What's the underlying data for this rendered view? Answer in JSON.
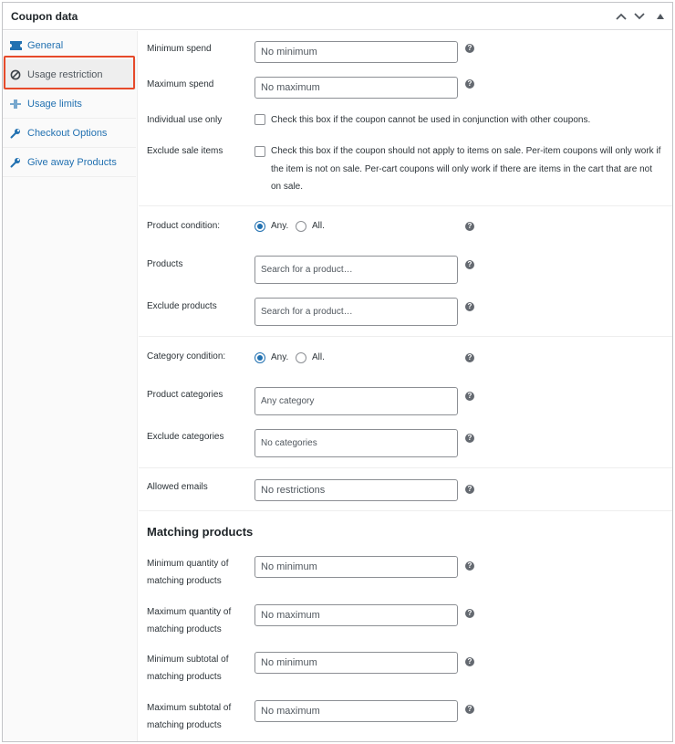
{
  "panel": {
    "title": "Coupon data"
  },
  "tabs": [
    {
      "label": "General",
      "icon": "ticket-icon"
    },
    {
      "label": "Usage restriction",
      "icon": "block-icon",
      "active": true
    },
    {
      "label": "Usage limits",
      "icon": "limits-icon"
    },
    {
      "label": "Checkout Options",
      "icon": "wrench-icon"
    },
    {
      "label": "Give away Products",
      "icon": "wrench-icon"
    }
  ],
  "fields": {
    "minimum_spend": {
      "label": "Minimum spend",
      "placeholder": "No minimum"
    },
    "maximum_spend": {
      "label": "Maximum spend",
      "placeholder": "No maximum"
    },
    "individual_use": {
      "label": "Individual use only",
      "text": "Check this box if the coupon cannot be used in conjunction with other coupons."
    },
    "exclude_sale": {
      "label": "Exclude sale items",
      "text": "Check this box if the coupon should not apply to items on sale. Per-item coupons will only work if the item is not on sale. Per-cart coupons will only work if there are items in the cart that are not on sale."
    },
    "product_condition": {
      "label": "Product condition:",
      "any": "Any.",
      "all": "All."
    },
    "products": {
      "label": "Products",
      "placeholder": "Search for a product…"
    },
    "exclude_products": {
      "label": "Exclude products",
      "placeholder": "Search for a product…"
    },
    "category_condition": {
      "label": "Category condition:",
      "any": "Any.",
      "all": "All."
    },
    "product_categories": {
      "label": "Product categories",
      "placeholder": "Any category"
    },
    "exclude_categories": {
      "label": "Exclude categories",
      "placeholder": "No categories"
    },
    "allowed_emails": {
      "label": "Allowed emails",
      "placeholder": "No restrictions"
    }
  },
  "matching": {
    "title": "Matching products",
    "min_qty": {
      "label_1": "Minimum quantity of",
      "label_2": "matching products",
      "placeholder": "No minimum"
    },
    "max_qty": {
      "label_1": "Maximum quantity of",
      "label_2": "matching products",
      "placeholder": "No maximum"
    },
    "min_subtotal": {
      "label_1": "Minimum subtotal of",
      "label_2": "matching products",
      "placeholder": "No minimum"
    },
    "max_subtotal": {
      "label_1": "Maximum subtotal of",
      "label_2": "matching products",
      "placeholder": "No maximum"
    }
  },
  "help_glyph": "?",
  "colors": {
    "link": "#2271b1",
    "highlight": "#e64a2a",
    "radio": "#2271b1"
  }
}
